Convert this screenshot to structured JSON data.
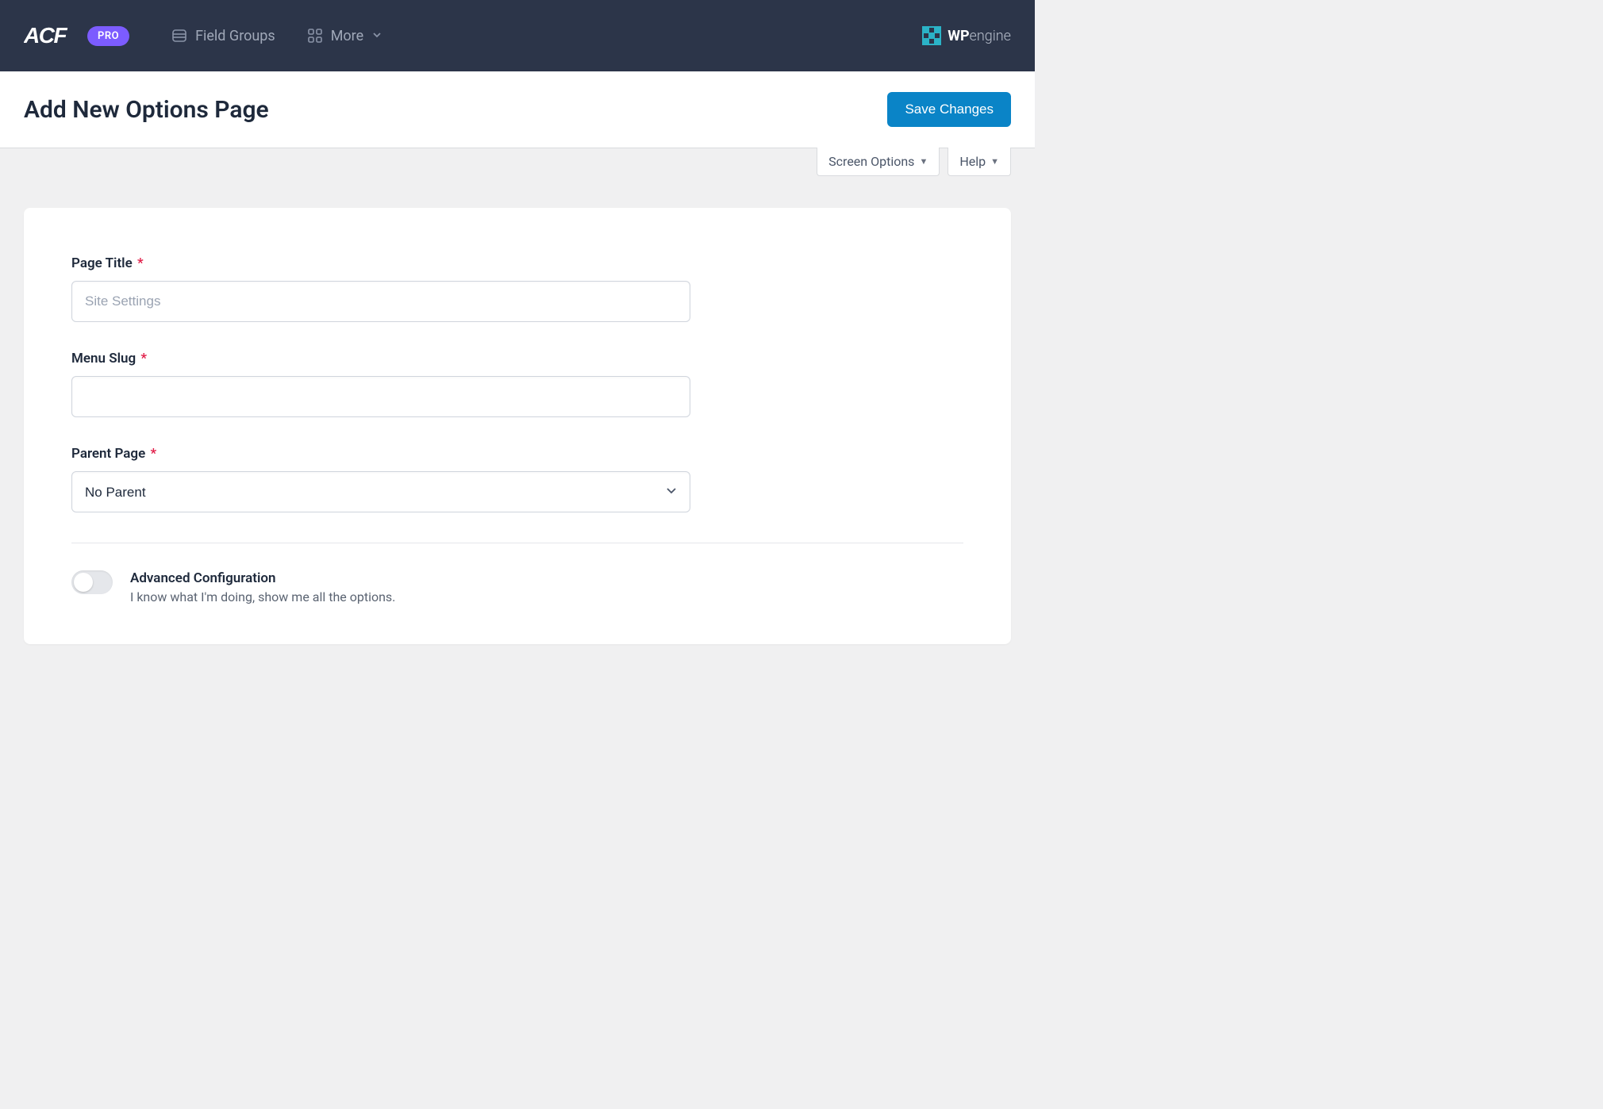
{
  "topbar": {
    "logo_text": "ACF",
    "pro_badge": "PRO",
    "nav": {
      "field_groups": "Field Groups",
      "more": "More"
    },
    "wpengine": {
      "bold": "WP",
      "light": "engine"
    }
  },
  "header": {
    "title": "Add New Options Page",
    "save_label": "Save Changes"
  },
  "meta": {
    "screen_options": "Screen Options",
    "help": "Help"
  },
  "form": {
    "page_title": {
      "label": "Page Title",
      "placeholder": "Site Settings",
      "value": ""
    },
    "menu_slug": {
      "label": "Menu Slug",
      "value": ""
    },
    "parent_page": {
      "label": "Parent Page",
      "selected": "No Parent"
    },
    "advanced": {
      "title": "Advanced Configuration",
      "description": "I know what I'm doing, show me all the options."
    }
  }
}
